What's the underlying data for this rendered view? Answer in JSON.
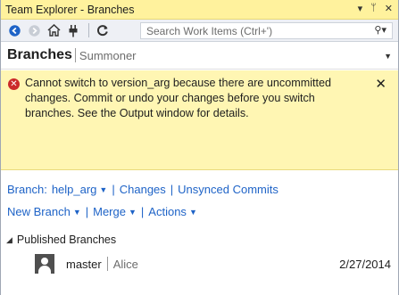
{
  "window": {
    "title": "Team Explorer - Branches",
    "controls": {
      "dropdown": "▾",
      "pin": "ᛘ",
      "close": "✕"
    }
  },
  "toolbar": {
    "search_placeholder": "Search Work Items (Ctrl+')",
    "search_icon": "⚲▾"
  },
  "header": {
    "title": "Branches",
    "project": "Summoner"
  },
  "notification": {
    "icon": "x-circle-icon",
    "message": "Cannot switch to version_arg because there are uncommitted changes. Commit or undo your changes before you switch branches. See the Output window for details.",
    "close": "✕"
  },
  "links": {
    "branch_label": "Branch:",
    "branch_value": "help_arg",
    "changes": "Changes",
    "unsynced": "Unsynced Commits",
    "new_branch": "New Branch",
    "merge": "Merge",
    "actions": "Actions"
  },
  "published": {
    "section_title": "Published Branches",
    "branches": [
      {
        "name": "master",
        "owner": "Alice",
        "date": "2/27/2014"
      }
    ]
  },
  "colors": {
    "title_bg": "#fff29d",
    "notice_bg": "#fff6b3",
    "link": "#1e63c7",
    "error": "#cb2a2a"
  }
}
